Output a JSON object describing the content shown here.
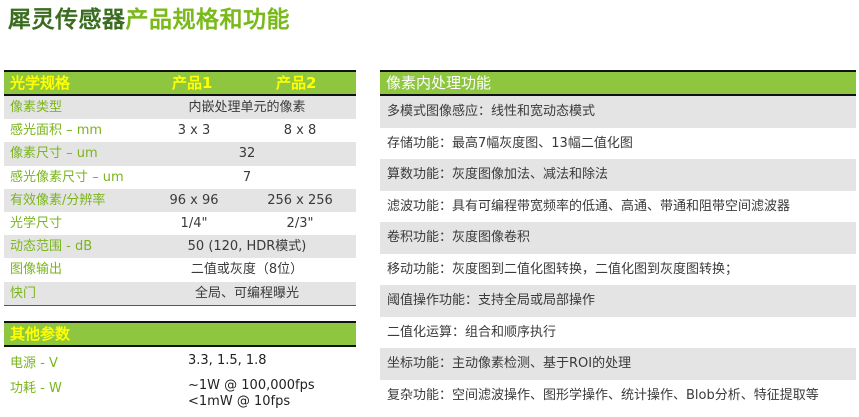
{
  "title": {
    "part1": "犀灵传感器",
    "part2": "产品规格和功能"
  },
  "optical": {
    "header": {
      "label": "光学规格",
      "p1": "产品1",
      "p2": "产品2"
    },
    "rows": [
      {
        "label": "像素类型",
        "span": "内嵌处理单元的像素"
      },
      {
        "label": "感光面积 – mm",
        "v1": "3 x 3",
        "v2": "8 x 8"
      },
      {
        "label": "像素尺寸 – um",
        "span": "32"
      },
      {
        "label": "感光像素尺寸 – um",
        "span": "7"
      },
      {
        "label": "有效像素/分辨率",
        "v1": "96 x 96",
        "v2": "256 x 256"
      },
      {
        "label": "光学尺寸",
        "v1": "1/4\"",
        "v2": "2/3\""
      },
      {
        "label": "动态范围 - dB",
        "span": "50 (120, HDR模式)"
      },
      {
        "label": "图像输出",
        "span": "二值或灰度（8位）"
      },
      {
        "label": "快门",
        "span": "全局、可编程曝光"
      }
    ]
  },
  "other": {
    "header": "其他参数",
    "power_label": "电源 - V",
    "power_value": "3.3, 1.5, 1.8",
    "consumption_label": "功耗 - W",
    "consumption_line1": "~1W @ 100,000fps",
    "consumption_line2": "<1mW @ 10fps"
  },
  "processing": {
    "header": "像素内处理功能",
    "items": [
      "多模式图像感应：线性和宽动态模式",
      "存储功能：最高7幅灰度图、13幅二值化图",
      "算数功能：灰度图像加法、减法和除法",
      "滤波功能：具有可编程带宽频率的低通、高通、带通和阻带空间滤波器",
      "卷积功能：灰度图像卷积",
      "移动功能：灰度图到二值化图转换，二值化图到灰度图转换；",
      "阈值操作功能：支持全局或局部操作",
      "二值化运算：组合和顺序执行",
      "坐标功能：主动像素检测、基于ROI的处理",
      "复杂功能：空间滤波操作、图形学操作、统计操作、Blob分析、特征提取等"
    ]
  }
}
